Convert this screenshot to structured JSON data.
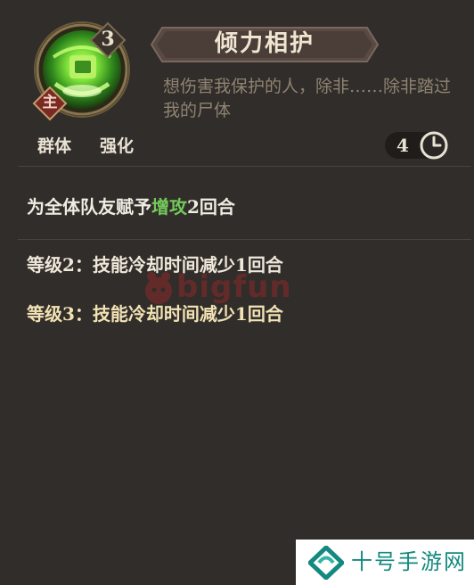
{
  "skill": {
    "name": "倾力相护",
    "level": "3",
    "main_tag": "主",
    "flavor": "想伤害我保护的人，除非……除非踏过我的尸体",
    "tags": [
      "群体",
      "强化"
    ],
    "cooldown": "4"
  },
  "description": {
    "prefix": "为全体队友赋予",
    "highlight": "增攻",
    "suffix": "2回合"
  },
  "upgrades": [
    "等级2：技能冷却时间减少1回合",
    "等级3：技能冷却时间减少1回合"
  ],
  "watermark": "bigfun",
  "site_logo": "十号手游网",
  "colors": {
    "background": "#312d2a",
    "highlight_green": "#74c95b",
    "level3_text": "#f2e2b4",
    "flavor_text": "#8f8372"
  },
  "icons": {
    "skill": "green-orb-skill-icon",
    "cooldown": "clock-icon"
  }
}
